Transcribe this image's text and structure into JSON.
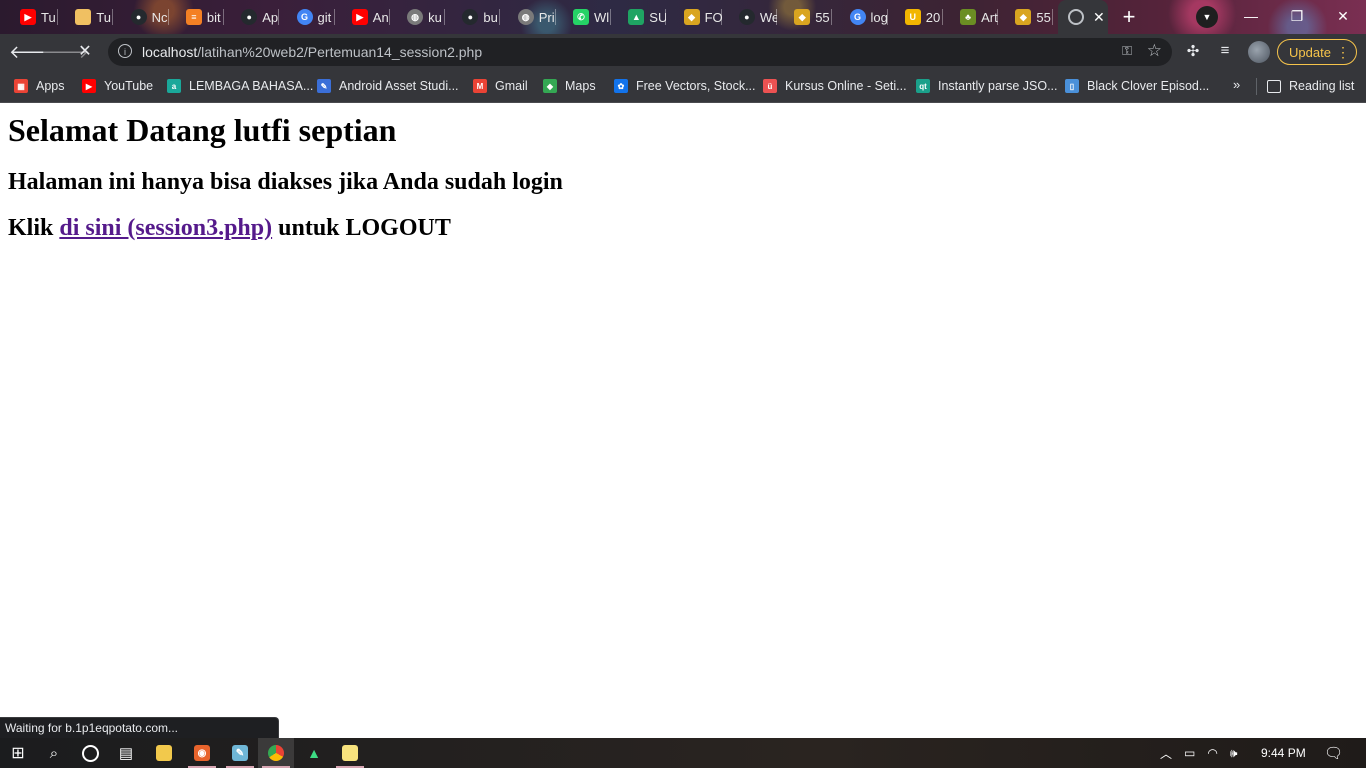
{
  "browser": {
    "tabs": [
      {
        "label": "Tu",
        "icon": "youtube-icon",
        "color": "#ff0000"
      },
      {
        "label": "Tu",
        "icon": "folder-icon",
        "color": "#f0c062"
      },
      {
        "label": "Nc",
        "icon": "github-icon",
        "color": "#24292e"
      },
      {
        "label": "bit",
        "icon": "stackoverflow-icon",
        "color": "#f48024"
      },
      {
        "label": "Ap",
        "icon": "github-icon",
        "color": "#24292e"
      },
      {
        "label": "git",
        "icon": "google-icon",
        "color": "#4285f4"
      },
      {
        "label": "An",
        "icon": "youtube-icon",
        "color": "#ff0000"
      },
      {
        "label": "ku",
        "icon": "globe-icon",
        "color": "#7a7a7a"
      },
      {
        "label": "bu",
        "icon": "github-icon",
        "color": "#24292e"
      },
      {
        "label": "Pri",
        "icon": "globe-icon",
        "color": "#7a7a7a"
      },
      {
        "label": "Wl",
        "icon": "whatsapp-icon",
        "color": "#25d366"
      },
      {
        "label": "SU",
        "icon": "drive-icon",
        "color": "#1fa463"
      },
      {
        "label": "FO",
        "icon": "gem-icon",
        "color": "#d9a520"
      },
      {
        "label": "We",
        "icon": "github-icon",
        "color": "#24292e"
      },
      {
        "label": "55",
        "icon": "gem-icon",
        "color": "#d9a520"
      },
      {
        "label": "log",
        "icon": "google-icon",
        "color": "#4285f4"
      },
      {
        "label": "20",
        "icon": "u-icon",
        "color": "#f2b600"
      },
      {
        "label": "Art",
        "icon": "leaf-icon",
        "color": "#6b8e23"
      },
      {
        "label": "55",
        "icon": "gem-icon",
        "color": "#d9a520"
      }
    ],
    "active_tab_close": "✕",
    "new_tab": "+",
    "window_controls": {
      "minimize": "—",
      "restore": "❐",
      "close": "✕"
    },
    "url_host": "localhost",
    "url_path": "/latihan%20web2/Pertemuan14_session2.php",
    "update_label": "Update",
    "bookmarks": [
      {
        "label": "Apps",
        "icon": "apps-grid-icon",
        "color": "#ea4335"
      },
      {
        "label": "YouTube",
        "icon": "youtube-icon",
        "color": "#ff0000"
      },
      {
        "label": "LEMBAGA BAHASA...",
        "icon": "lembaga-icon",
        "color": "#1aa89a"
      },
      {
        "label": "Android Asset Studi...",
        "icon": "android-studio-icon",
        "color": "#3b6fd8"
      },
      {
        "label": "Gmail",
        "icon": "gmail-icon",
        "color": "#ea4335"
      },
      {
        "label": "Maps",
        "icon": "maps-icon",
        "color": "#34a853"
      },
      {
        "label": "Free Vectors, Stock...",
        "icon": "freepik-icon",
        "color": "#1273eb"
      },
      {
        "label": "Kursus Online - Seti...",
        "icon": "udemy-icon",
        "color": "#ec5252"
      },
      {
        "label": "Instantly parse JSO...",
        "icon": "quicktype-icon",
        "color": "#1aa08a"
      },
      {
        "label": "Black Clover Episod...",
        "icon": "page-icon",
        "color": "#4a90d9"
      }
    ],
    "bookmarks_more": "»",
    "reading_list": "Reading list",
    "status_text": "Waiting for b.1p1eqpotato.com..."
  },
  "page": {
    "heading": "Selamat Datang lutfi septian",
    "notice": "Halaman ini hanya bisa diakses jika Anda sudah login",
    "logout_prefix": "Klik",
    "logout_link": "di sini (session3.php)",
    "logout_suffix": "untuk LOGOUT"
  },
  "taskbar": {
    "items": [
      {
        "name": "start-button",
        "icon": "windows-icon"
      },
      {
        "name": "search-button",
        "icon": "search-icon"
      },
      {
        "name": "cortana-button",
        "icon": "cortana-icon"
      },
      {
        "name": "task-view-button",
        "icon": "task-view-icon"
      },
      {
        "name": "file-explorer",
        "icon": "folder-icon"
      },
      {
        "name": "app-orange",
        "icon": "app-orange-icon"
      },
      {
        "name": "app-paint",
        "icon": "paint-icon"
      },
      {
        "name": "chrome",
        "icon": "chrome-icon"
      },
      {
        "name": "android-studio",
        "icon": "android-icon"
      },
      {
        "name": "notepad",
        "icon": "notepad-icon"
      }
    ],
    "clock": "9:44 PM"
  }
}
